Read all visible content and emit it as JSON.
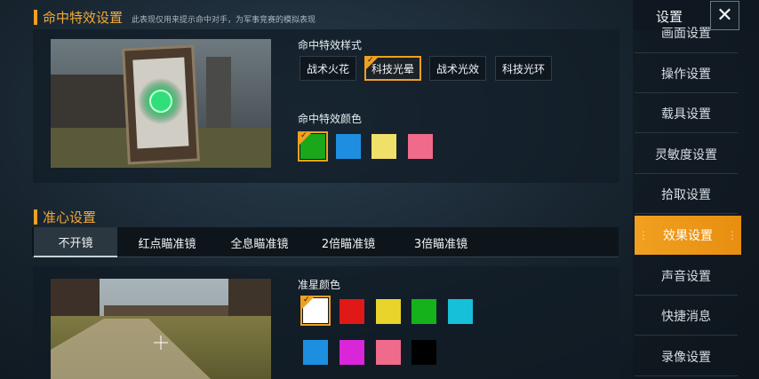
{
  "hit_effect": {
    "title": "命中特效设置",
    "note": "此表现仅用来提示命中对手，为军事竞赛的模拟表现",
    "style_label": "命中特效样式",
    "styles": [
      "战术火花",
      "科技光晕",
      "战术光效",
      "科技光环"
    ],
    "selected_style": "科技光晕",
    "color_label": "命中特效颜色",
    "colors": [
      "#1aa81a",
      "#1e8fe0",
      "#efe06a",
      "#f06a8c"
    ],
    "selected_color": "#1aa81a"
  },
  "crosshair": {
    "title": "准心设置",
    "tabs": [
      "不开镜",
      "红点瞄准镜",
      "全息瞄准镜",
      "2倍瞄准镜",
      "3倍瞄准镜"
    ],
    "selected_tab": "不开镜",
    "color_label": "准星颜色",
    "colors_row1": [
      "#ffffff",
      "#e01818",
      "#e8d42a",
      "#16b21c",
      "#16c0d8"
    ],
    "colors_row2": [
      "#1e8fe0",
      "#d826d8",
      "#f06a8c",
      "#000000"
    ],
    "selected_color": "#ffffff"
  },
  "sidebar": {
    "title": "设置",
    "close_icon": "close-icon",
    "items": [
      "画面设置",
      "操作设置",
      "载具设置",
      "灵敏度设置",
      "拾取设置",
      "效果设置",
      "声音设置",
      "快捷消息",
      "录像设置"
    ],
    "selected": "效果设置"
  },
  "accent": "#f0a020"
}
